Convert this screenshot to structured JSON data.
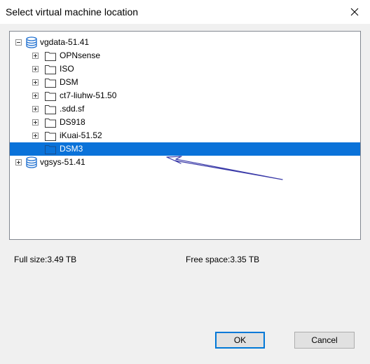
{
  "dialog": {
    "title": "Select virtual machine location",
    "close_icon": "close-icon"
  },
  "tree": {
    "nodes": [
      {
        "label": "vgdata-51.41",
        "icon": "database-icon",
        "expanded": true,
        "level": 0,
        "selected": false
      },
      {
        "label": "OPNsense",
        "icon": "folder-icon",
        "expanded": false,
        "level": 1,
        "selected": false
      },
      {
        "label": "ISO",
        "icon": "folder-icon",
        "expanded": false,
        "level": 1,
        "selected": false
      },
      {
        "label": "DSM",
        "icon": "folder-icon",
        "expanded": false,
        "level": 1,
        "selected": false
      },
      {
        "label": "ct7-liuhw-51.50",
        "icon": "folder-icon",
        "expanded": false,
        "level": 1,
        "selected": false
      },
      {
        "label": ".sdd.sf",
        "icon": "folder-icon",
        "expanded": false,
        "level": 1,
        "selected": false
      },
      {
        "label": "DS918",
        "icon": "folder-icon",
        "expanded": false,
        "level": 1,
        "selected": false
      },
      {
        "label": "iKuai-51.52",
        "icon": "folder-icon",
        "expanded": false,
        "level": 1,
        "selected": false
      },
      {
        "label": "DSM3",
        "icon": "folder-icon",
        "expanded": false,
        "level": 1,
        "selected": true
      },
      {
        "label": "vgsys-51.41",
        "icon": "database-icon",
        "expanded": false,
        "level": 0,
        "selected": false
      }
    ]
  },
  "info": {
    "full_size": "Full size:3.49 TB",
    "free_space": "Free space:3.35 TB"
  },
  "buttons": {
    "ok": "OK",
    "cancel": "Cancel"
  },
  "colors": {
    "selection": "#0a72d9",
    "default_button_border": "#0078d7",
    "annotation_arrow": "#3a3aa8"
  }
}
